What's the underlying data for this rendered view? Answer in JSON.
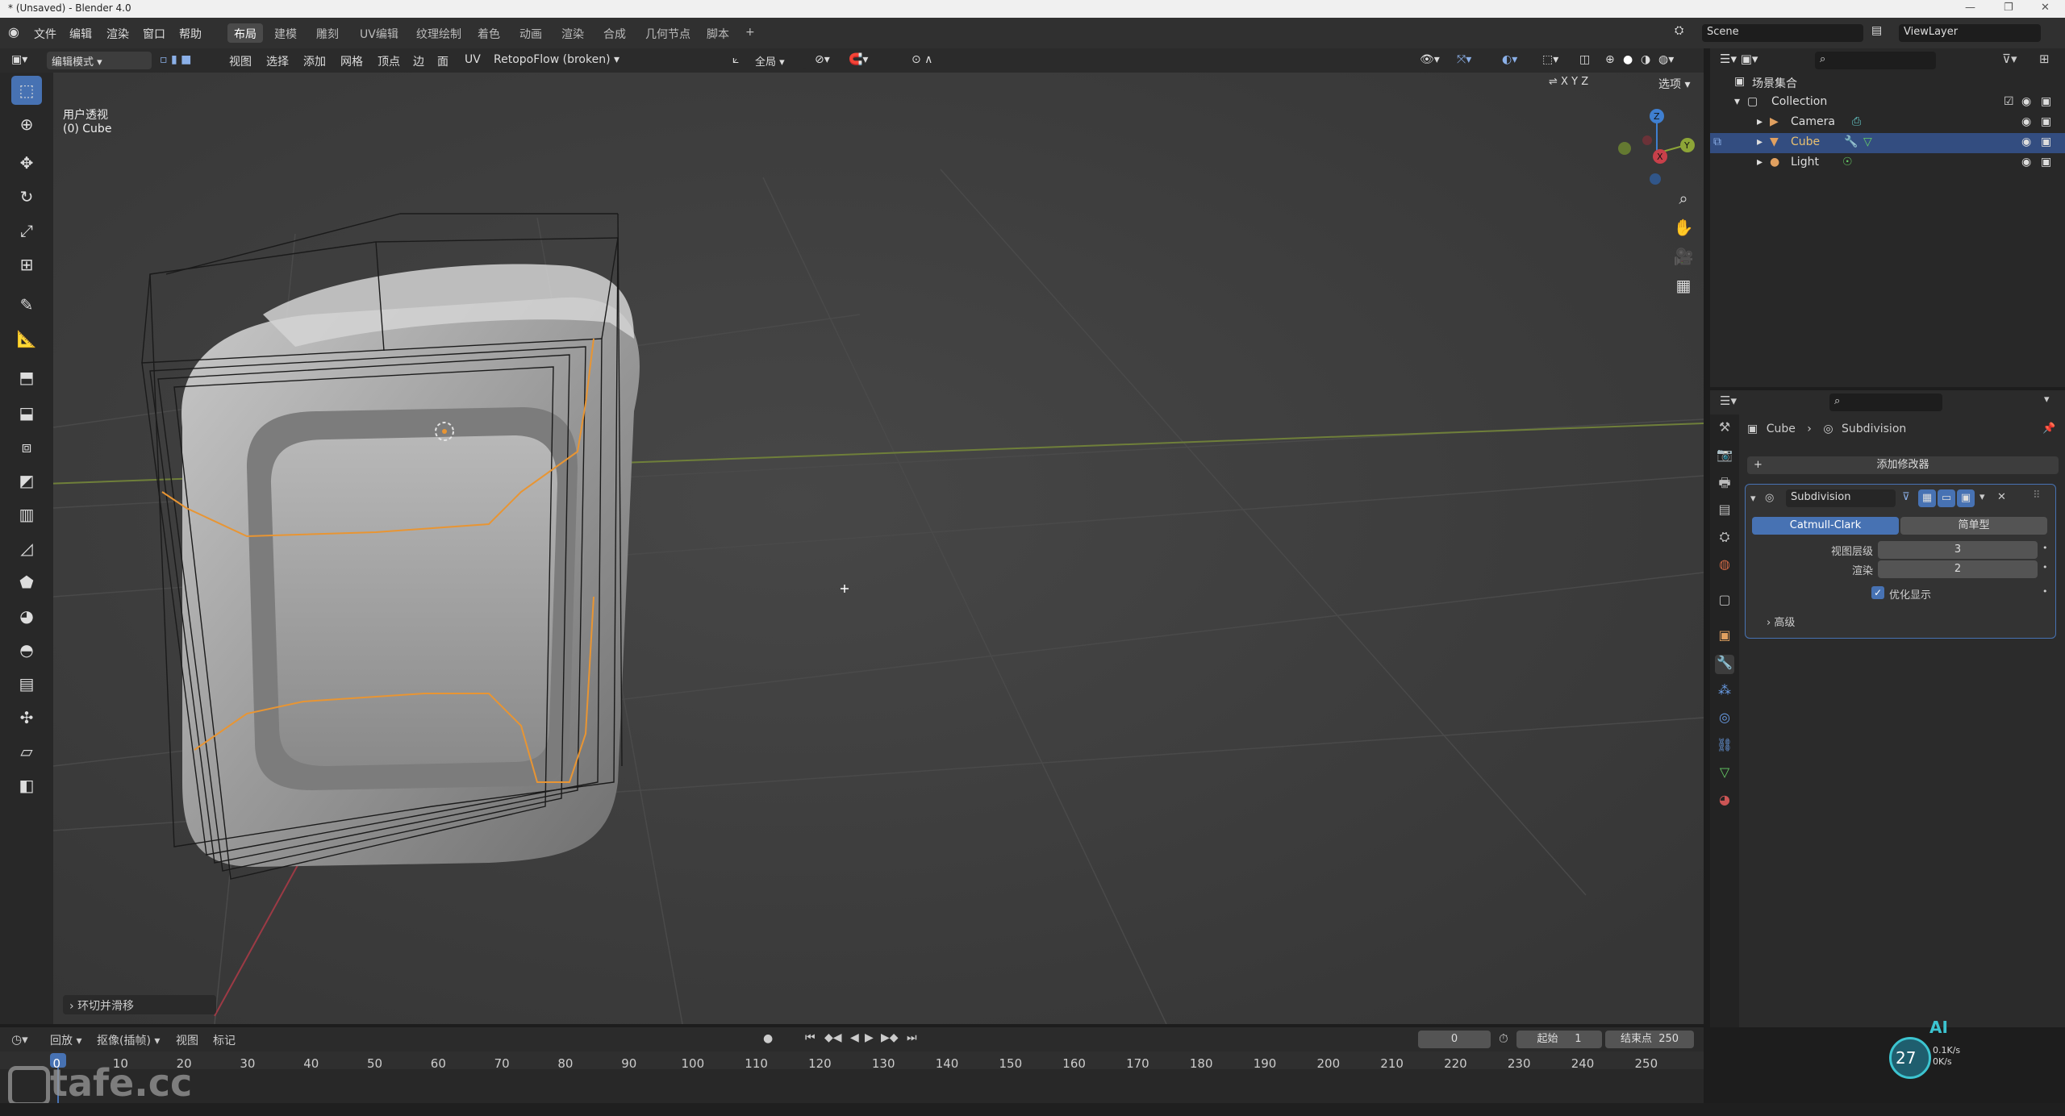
{
  "window": {
    "title": "* (Unsaved) - Blender 4.0"
  },
  "menubar": {
    "items": [
      "文件",
      "编辑",
      "渲染",
      "窗口",
      "帮助"
    ],
    "workspaces": [
      "布局",
      "建模",
      "雕刻",
      "UV编辑",
      "纹理绘制",
      "着色",
      "动画",
      "渲染",
      "合成",
      "几何节点",
      "脚本"
    ],
    "active_workspace": "布局",
    "add_tab": "+",
    "scene_name": "Scene",
    "view_layer": "ViewLayer"
  },
  "viewport_header": {
    "mode": "编辑模式",
    "menus": [
      "视图",
      "选择",
      "添加",
      "网格",
      "顶点",
      "边",
      "面",
      "UV"
    ],
    "addon": "RetopoFlow (broken)",
    "transform_orientation": "全局",
    "options_label": "选项",
    "axes": [
      "X",
      "Y",
      "Z"
    ]
  },
  "viewport": {
    "view_label": "用户透视",
    "object_label": "(0) Cube",
    "operator_panel": "环切并滑移"
  },
  "outliner": {
    "root": "场景集合",
    "collection": "Collection",
    "objects": [
      {
        "name": "Camera",
        "selected": false
      },
      {
        "name": "Cube",
        "selected": true
      },
      {
        "name": "Light",
        "selected": false
      }
    ]
  },
  "properties": {
    "breadcrumb_object": "Cube",
    "breadcrumb_modifier": "Subdivision",
    "add_modifier": "添加修改器",
    "modifier": {
      "name": "Subdivision",
      "type_active": "Catmull-Clark",
      "type_other": "简单型",
      "fields": [
        {
          "label": "视图层级",
          "value": "3"
        },
        {
          "label": "渲染",
          "value": "2"
        }
      ],
      "checkbox_label": "优化显示",
      "advanced": "高级"
    }
  },
  "timeline": {
    "menus": [
      "回放",
      "抠像(插帧)",
      "视图",
      "标记"
    ],
    "current_frame": "0",
    "start_label": "起始",
    "start": "1",
    "end_label": "结束点",
    "end": "250",
    "ticks": [
      "0",
      "10",
      "20",
      "30",
      "40",
      "50",
      "60",
      "70",
      "80",
      "90",
      "100",
      "110",
      "120",
      "130",
      "140",
      "150",
      "160",
      "170",
      "180",
      "190",
      "200",
      "210",
      "220",
      "230",
      "240",
      "250"
    ]
  },
  "overlay": {
    "watermark": "tafe.cc",
    "ai_label": "AI",
    "ai_percent": "27",
    "net_up": "0.1K/s",
    "net_down": "0K/s"
  },
  "colors": {
    "accent": "#4772b3",
    "selected_row": "#334d80",
    "wire_orange": "#e89533",
    "axis_red": "#c8404a",
    "axis_green": "#8da537"
  }
}
